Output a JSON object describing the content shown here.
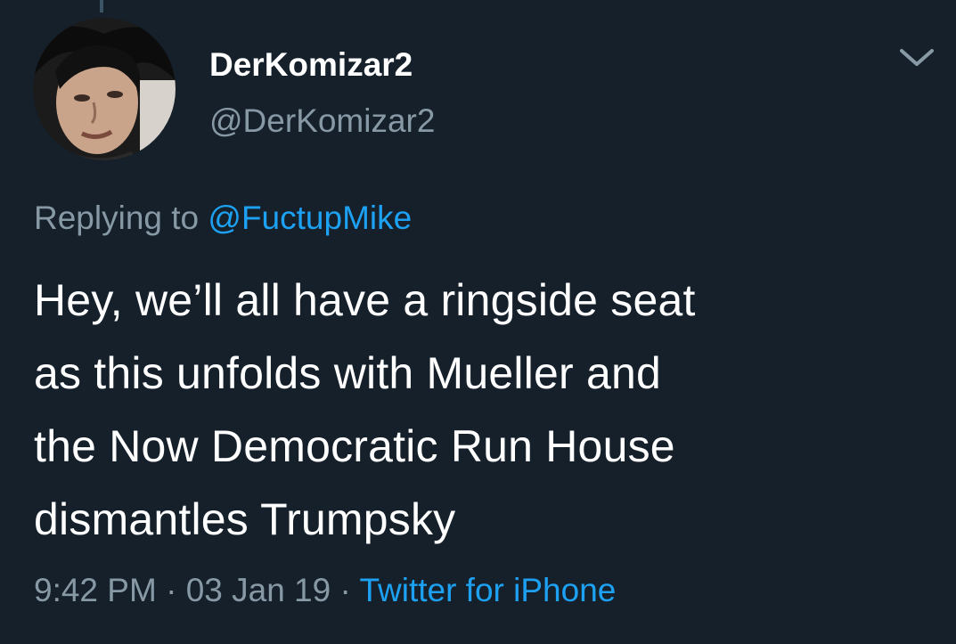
{
  "author": {
    "display_name": "DerKomizar2",
    "handle": "@DerKomizar2"
  },
  "reply": {
    "prefix": "Replying to ",
    "mention": "@FuctupMike"
  },
  "tweet": {
    "lines": [
      "Hey, we’ll all have a ringside seat",
      "as this unfolds with Mueller and",
      "the Now Democratic Run House",
      "dismantles Trumpsky"
    ]
  },
  "meta": {
    "time": "9:42 PM",
    "separator_1": " · ",
    "date": "03 Jan 19",
    "separator_2": " · ",
    "source": "Twitter for iPhone"
  },
  "icons": {
    "menu": "chevron-down-icon"
  },
  "colors": {
    "background": "#15202b",
    "secondary_text": "#8899a6",
    "link": "#1da1f2"
  }
}
